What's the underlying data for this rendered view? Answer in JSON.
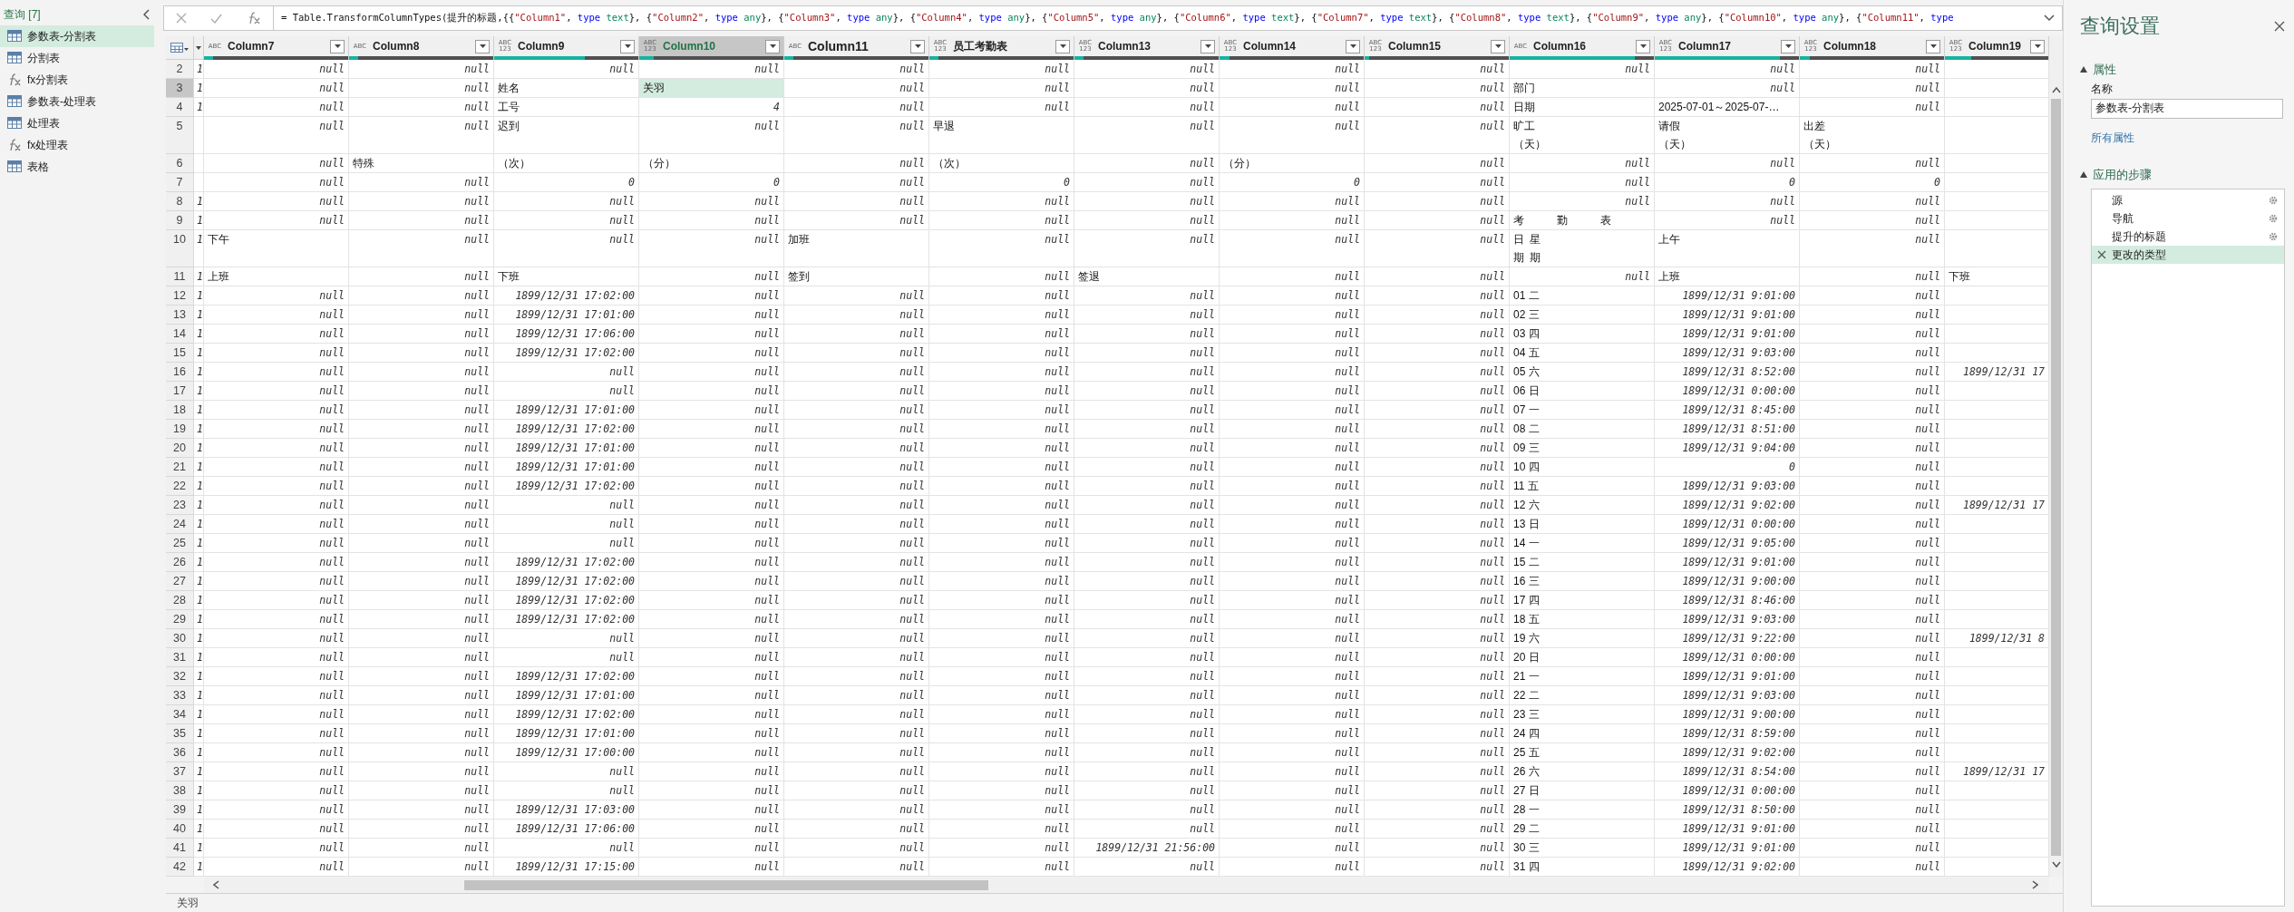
{
  "sidebar": {
    "title": "查询 [7]",
    "items": [
      {
        "label": "参数表-分割表",
        "kind": "table",
        "selected": true
      },
      {
        "label": "分割表",
        "kind": "table",
        "selected": false
      },
      {
        "label": "fx分割表",
        "kind": "function",
        "selected": false
      },
      {
        "label": "参数表-处理表",
        "kind": "table",
        "selected": false
      },
      {
        "label": "处理表",
        "kind": "table",
        "selected": false
      },
      {
        "label": "fx处理表",
        "kind": "function",
        "selected": false
      },
      {
        "label": "表格",
        "kind": "table",
        "selected": false
      }
    ]
  },
  "formula_bar": {
    "segments": [
      {
        "kind": "plain",
        "text": "= Table.TransformColumnTypes(提升的标题,{{"
      },
      {
        "kind": "string",
        "text": "\"Column1\""
      },
      {
        "kind": "plain",
        "text": ", "
      },
      {
        "kind": "keyword",
        "text": "type"
      },
      {
        "kind": "type",
        "text": " text"
      },
      {
        "kind": "plain",
        "text": "}, {"
      },
      {
        "kind": "string",
        "text": "\"Column2\""
      },
      {
        "kind": "plain",
        "text": ", "
      },
      {
        "kind": "keyword",
        "text": "type"
      },
      {
        "kind": "type",
        "text": " any"
      },
      {
        "kind": "plain",
        "text": "}, {"
      },
      {
        "kind": "string",
        "text": "\"Column3\""
      },
      {
        "kind": "plain",
        "text": ", "
      },
      {
        "kind": "keyword",
        "text": "type"
      },
      {
        "kind": "type",
        "text": " any"
      },
      {
        "kind": "plain",
        "text": "}, {"
      },
      {
        "kind": "string",
        "text": "\"Column4\""
      },
      {
        "kind": "plain",
        "text": ", "
      },
      {
        "kind": "keyword",
        "text": "type"
      },
      {
        "kind": "type",
        "text": " any"
      },
      {
        "kind": "plain",
        "text": "}, {"
      },
      {
        "kind": "string",
        "text": "\"Column5\""
      },
      {
        "kind": "plain",
        "text": ", "
      },
      {
        "kind": "keyword",
        "text": "type"
      },
      {
        "kind": "type",
        "text": " any"
      },
      {
        "kind": "plain",
        "text": "}, {"
      },
      {
        "kind": "string",
        "text": "\"Column6\""
      },
      {
        "kind": "plain",
        "text": ", "
      },
      {
        "kind": "keyword",
        "text": "type"
      },
      {
        "kind": "type",
        "text": " text"
      },
      {
        "kind": "plain",
        "text": "}, {"
      },
      {
        "kind": "string",
        "text": "\"Column7\""
      },
      {
        "kind": "plain",
        "text": ", "
      },
      {
        "kind": "keyword",
        "text": "type"
      },
      {
        "kind": "type",
        "text": " text"
      },
      {
        "kind": "plain",
        "text": "}, {"
      },
      {
        "kind": "string",
        "text": "\"Column8\""
      },
      {
        "kind": "plain",
        "text": ", "
      },
      {
        "kind": "keyword",
        "text": "type"
      },
      {
        "kind": "type",
        "text": " text"
      },
      {
        "kind": "plain",
        "text": "}, {"
      },
      {
        "kind": "string",
        "text": "\"Column9\""
      },
      {
        "kind": "plain",
        "text": ", "
      },
      {
        "kind": "keyword",
        "text": "type"
      },
      {
        "kind": "type",
        "text": " any"
      },
      {
        "kind": "plain",
        "text": "}, {"
      },
      {
        "kind": "string",
        "text": "\"Column10\""
      },
      {
        "kind": "plain",
        "text": ", "
      },
      {
        "kind": "keyword",
        "text": "type"
      },
      {
        "kind": "type",
        "text": " any"
      },
      {
        "kind": "plain",
        "text": "}, {"
      },
      {
        "kind": "string",
        "text": "\"Column11\""
      },
      {
        "kind": "plain",
        "text": ", "
      },
      {
        "kind": "keyword",
        "text": "type"
      }
    ]
  },
  "table": {
    "columns": [
      {
        "kind": "clipped",
        "selected": false
      },
      {
        "name": "Column7",
        "type": "ABC",
        "level": 0.06,
        "selected": false
      },
      {
        "name": "Column8",
        "type": "ABC",
        "level": 0.06,
        "selected": false
      },
      {
        "name": "Column9",
        "type": "ABC\n123",
        "level": 0.63,
        "selected": false
      },
      {
        "name": "Column10",
        "type": "ABC\n123",
        "level": 0.1,
        "selected": true
      },
      {
        "name": "Column11",
        "type": "ABC",
        "level": 0.06,
        "selected": false
      },
      {
        "name": "员工考勤表",
        "type": "ABC\n123",
        "level": 0.06,
        "selected": false
      },
      {
        "name": "Column13",
        "type": "ABC\n123",
        "level": 0.06,
        "selected": false
      },
      {
        "name": "Column14",
        "type": "ABC\n123",
        "level": 0.07,
        "selected": false
      },
      {
        "name": "Column15",
        "type": "ABC\n123",
        "level": 0.03,
        "selected": false
      },
      {
        "name": "Column16",
        "type": "ABC",
        "level": 0.87,
        "selected": false
      },
      {
        "name": "Column17",
        "type": "ABC\n123",
        "level": 0.87,
        "selected": false
      },
      {
        "name": "Column18",
        "type": "ABC\n123",
        "level": 0.07,
        "selected": false
      },
      {
        "name": "Column19",
        "type": "ABC\n123",
        "level": 0.25,
        "selected": false
      }
    ],
    "rows": [
      {
        "row": "2",
        "selected": false,
        "cells": [
          "1",
          "null",
          "null",
          "null",
          "null",
          "null",
          "null",
          "null",
          "null",
          "null",
          "null",
          "null",
          "null",
          null
        ]
      },
      {
        "row": "3",
        "selected": true,
        "cells": [
          "1",
          "null",
          "null",
          {
            "text": "姓名"
          },
          {
            "text": "关羽"
          },
          "null",
          "null",
          "null",
          "null",
          "null",
          {
            "text": "部门"
          },
          "null",
          "null",
          null
        ]
      },
      {
        "row": "4",
        "selected": false,
        "cells": [
          "1",
          "null",
          "null",
          {
            "text": "工号"
          },
          "4",
          "null",
          "null",
          "null",
          "null",
          "null",
          {
            "text": "日期"
          },
          {
            "text": "2025-07-01～2025-07-…"
          },
          "null",
          null
        ]
      },
      {
        "row": "5",
        "selected": false,
        "cells": [
          null,
          "null",
          "null",
          {
            "text": "迟到"
          },
          "null",
          "null",
          {
            "text": "早退"
          },
          "null",
          "null",
          "null",
          {
            "kind": "stacked",
            "text": "旷工（天）"
          },
          {
            "kind": "stacked",
            "text": "请假（天）"
          },
          {
            "kind": "stacked",
            "text": "出差（天）"
          },
          null
        ]
      },
      {
        "row": "6",
        "selected": false,
        "cells": [
          null,
          "null",
          {
            "text": "特殊"
          },
          {
            "text": "（次）"
          },
          {
            "text": "（分）"
          },
          "null",
          {
            "text": "（次）"
          },
          "null",
          {
            "text": "（分）"
          },
          "null",
          "null",
          "null",
          "null",
          null
        ]
      },
      {
        "row": "7",
        "selected": false,
        "cells": [
          null,
          "null",
          "null",
          "0",
          "0",
          "null",
          "0",
          "null",
          "0",
          "null",
          "null",
          "0",
          "0",
          null
        ]
      },
      {
        "row": "8",
        "selected": false,
        "cells": [
          "1",
          "null",
          "null",
          "null",
          "null",
          "null",
          "null",
          "null",
          "null",
          "null",
          "null",
          "null",
          "null",
          null
        ]
      },
      {
        "row": "9",
        "selected": false,
        "cells": [
          "1",
          "null",
          "null",
          "null",
          "null",
          "null",
          "null",
          "null",
          "null",
          "null",
          {
            "text": "考　　　勤　　　表"
          },
          "null",
          "null",
          null
        ]
      },
      {
        "row": "10",
        "selected": false,
        "cells": [
          "1",
          {
            "text": "下午"
          },
          "null",
          "null",
          "null",
          {
            "text": "加班"
          },
          "null",
          "null",
          "null",
          "null",
          {
            "kind": "vertical",
            "texts": [
              "日期",
              "星期"
            ]
          },
          {
            "text": "上午"
          },
          "null",
          null
        ]
      },
      {
        "row": "11",
        "selected": false,
        "cells": [
          "1",
          {
            "text": "上班"
          },
          "null",
          {
            "text": "下班"
          },
          "null",
          {
            "text": "签到"
          },
          "null",
          {
            "text": "签退"
          },
          "null",
          "null",
          "null",
          {
            "text": "上班"
          },
          "null",
          {
            "text": "下班"
          }
        ]
      },
      {
        "row": "12",
        "selected": false,
        "cells": [
          "1",
          "null",
          "null",
          "1899/12/31 17:02:00",
          "null",
          "null",
          "null",
          "null",
          "null",
          "null",
          {
            "text": "01 二"
          },
          "1899/12/31 9:01:00",
          "null",
          null
        ]
      },
      {
        "row": "13",
        "selected": false,
        "cells": [
          "1",
          "null",
          "null",
          "1899/12/31 17:01:00",
          "null",
          "null",
          "null",
          "null",
          "null",
          "null",
          {
            "text": "02 三"
          },
          "1899/12/31 9:01:00",
          "null",
          null
        ]
      },
      {
        "row": "14",
        "selected": false,
        "cells": [
          "1",
          "null",
          "null",
          "1899/12/31 17:06:00",
          "null",
          "null",
          "null",
          "null",
          "null",
          "null",
          {
            "text": "03 四"
          },
          "1899/12/31 9:01:00",
          "null",
          null
        ]
      },
      {
        "row": "15",
        "selected": false,
        "cells": [
          "1",
          "null",
          "null",
          "1899/12/31 17:02:00",
          "null",
          "null",
          "null",
          "null",
          "null",
          "null",
          {
            "text": "04 五"
          },
          "1899/12/31 9:03:00",
          "null",
          null
        ]
      },
      {
        "row": "16",
        "selected": false,
        "cells": [
          "1",
          "null",
          "null",
          "null",
          "null",
          "null",
          "null",
          "null",
          "null",
          "null",
          {
            "text": "05 六"
          },
          "1899/12/31 8:52:00",
          "null",
          "1899/12/31 17"
        ]
      },
      {
        "row": "17",
        "selected": false,
        "cells": [
          "1",
          "null",
          "null",
          "null",
          "null",
          "null",
          "null",
          "null",
          "null",
          "null",
          {
            "text": "06 日"
          },
          "1899/12/31 0:00:00",
          "null",
          null
        ]
      },
      {
        "row": "18",
        "selected": false,
        "cells": [
          "1",
          "null",
          "null",
          "1899/12/31 17:01:00",
          "null",
          "null",
          "null",
          "null",
          "null",
          "null",
          {
            "text": "07 一"
          },
          "1899/12/31 8:45:00",
          "null",
          null
        ]
      },
      {
        "row": "19",
        "selected": false,
        "cells": [
          "1",
          "null",
          "null",
          "1899/12/31 17:02:00",
          "null",
          "null",
          "null",
          "null",
          "null",
          "null",
          {
            "text": "08 二"
          },
          "1899/12/31 8:51:00",
          "null",
          null
        ]
      },
      {
        "row": "20",
        "selected": false,
        "cells": [
          "1",
          "null",
          "null",
          "1899/12/31 17:01:00",
          "null",
          "null",
          "null",
          "null",
          "null",
          "null",
          {
            "text": "09 三"
          },
          "1899/12/31 9:04:00",
          "null",
          null
        ]
      },
      {
        "row": "21",
        "selected": false,
        "cells": [
          "1",
          "null",
          "null",
          "1899/12/31 17:01:00",
          "null",
          "null",
          "null",
          "null",
          "null",
          "null",
          {
            "text": "10 四"
          },
          "0",
          "null",
          null
        ]
      },
      {
        "row": "22",
        "selected": false,
        "cells": [
          "1",
          "null",
          "null",
          "1899/12/31 17:02:00",
          "null",
          "null",
          "null",
          "null",
          "null",
          "null",
          {
            "text": "11 五"
          },
          "1899/12/31 9:03:00",
          "null",
          null
        ]
      },
      {
        "row": "23",
        "selected": false,
        "cells": [
          "1",
          "null",
          "null",
          "null",
          "null",
          "null",
          "null",
          "null",
          "null",
          "null",
          {
            "text": "12 六"
          },
          "1899/12/31 9:02:00",
          "null",
          "1899/12/31 17"
        ]
      },
      {
        "row": "24",
        "selected": false,
        "cells": [
          "1",
          "null",
          "null",
          "null",
          "null",
          "null",
          "null",
          "null",
          "null",
          "null",
          {
            "text": "13 日"
          },
          "1899/12/31 0:00:00",
          "null",
          null
        ]
      },
      {
        "row": "25",
        "selected": false,
        "cells": [
          "1",
          "null",
          "null",
          "null",
          "null",
          "null",
          "null",
          "null",
          "null",
          "null",
          {
            "text": "14 一"
          },
          "1899/12/31 9:05:00",
          "null",
          null
        ]
      },
      {
        "row": "26",
        "selected": false,
        "cells": [
          "1",
          "null",
          "null",
          "1899/12/31 17:02:00",
          "null",
          "null",
          "null",
          "null",
          "null",
          "null",
          {
            "text": "15 二"
          },
          "1899/12/31 9:01:00",
          "null",
          null
        ]
      },
      {
        "row": "27",
        "selected": false,
        "cells": [
          "1",
          "null",
          "null",
          "1899/12/31 17:02:00",
          "null",
          "null",
          "null",
          "null",
          "null",
          "null",
          {
            "text": "16 三"
          },
          "1899/12/31 9:00:00",
          "null",
          null
        ]
      },
      {
        "row": "28",
        "selected": false,
        "cells": [
          "1",
          "null",
          "null",
          "1899/12/31 17:02:00",
          "null",
          "null",
          "null",
          "null",
          "null",
          "null",
          {
            "text": "17 四"
          },
          "1899/12/31 8:46:00",
          "null",
          null
        ]
      },
      {
        "row": "29",
        "selected": false,
        "cells": [
          "1",
          "null",
          "null",
          "1899/12/31 17:02:00",
          "null",
          "null",
          "null",
          "null",
          "null",
          "null",
          {
            "text": "18 五"
          },
          "1899/12/31 9:03:00",
          "null",
          null
        ]
      },
      {
        "row": "30",
        "selected": false,
        "cells": [
          "1",
          "null",
          "null",
          "null",
          "null",
          "null",
          "null",
          "null",
          "null",
          "null",
          {
            "text": "19 六"
          },
          "1899/12/31 9:22:00",
          "null",
          "1899/12/31 8"
        ]
      },
      {
        "row": "31",
        "selected": false,
        "cells": [
          "1",
          "null",
          "null",
          "null",
          "null",
          "null",
          "null",
          "null",
          "null",
          "null",
          {
            "text": "20 日"
          },
          "1899/12/31 0:00:00",
          "null",
          null
        ]
      },
      {
        "row": "32",
        "selected": false,
        "cells": [
          "1",
          "null",
          "null",
          "1899/12/31 17:02:00",
          "null",
          "null",
          "null",
          "null",
          "null",
          "null",
          {
            "text": "21 一"
          },
          "1899/12/31 9:01:00",
          "null",
          null
        ]
      },
      {
        "row": "33",
        "selected": false,
        "cells": [
          "1",
          "null",
          "null",
          "1899/12/31 17:01:00",
          "null",
          "null",
          "null",
          "null",
          "null",
          "null",
          {
            "text": "22 二"
          },
          "1899/12/31 9:03:00",
          "null",
          null
        ]
      },
      {
        "row": "34",
        "selected": false,
        "cells": [
          "1",
          "null",
          "null",
          "1899/12/31 17:02:00",
          "null",
          "null",
          "null",
          "null",
          "null",
          "null",
          {
            "text": "23 三"
          },
          "1899/12/31 9:00:00",
          "null",
          null
        ]
      },
      {
        "row": "35",
        "selected": false,
        "cells": [
          "1",
          "null",
          "null",
          "1899/12/31 17:01:00",
          "null",
          "null",
          "null",
          "null",
          "null",
          "null",
          {
            "text": "24 四"
          },
          "1899/12/31 8:59:00",
          "null",
          null
        ]
      },
      {
        "row": "36",
        "selected": false,
        "cells": [
          "1",
          "null",
          "null",
          "1899/12/31 17:00:00",
          "null",
          "null",
          "null",
          "null",
          "null",
          "null",
          {
            "text": "25 五"
          },
          "1899/12/31 9:02:00",
          "null",
          null
        ]
      },
      {
        "row": "37",
        "selected": false,
        "cells": [
          "1",
          "null",
          "null",
          "null",
          "null",
          "null",
          "null",
          "null",
          "null",
          "null",
          {
            "text": "26 六"
          },
          "1899/12/31 8:54:00",
          "null",
          "1899/12/31 17"
        ]
      },
      {
        "row": "38",
        "selected": false,
        "cells": [
          "1",
          "null",
          "null",
          "null",
          "null",
          "null",
          "null",
          "null",
          "null",
          "null",
          {
            "text": "27 日"
          },
          "1899/12/31 0:00:00",
          "null",
          null
        ]
      },
      {
        "row": "39",
        "selected": false,
        "cells": [
          "1",
          "null",
          "null",
          "1899/12/31 17:03:00",
          "null",
          "null",
          "null",
          "null",
          "null",
          "null",
          {
            "text": "28 一"
          },
          "1899/12/31 8:50:00",
          "null",
          null
        ]
      },
      {
        "row": "40",
        "selected": false,
        "cells": [
          "1",
          "null",
          "null",
          "1899/12/31 17:06:00",
          "null",
          "null",
          "null",
          "null",
          "null",
          "null",
          {
            "text": "29 二"
          },
          "1899/12/31 9:01:00",
          "null",
          null
        ]
      },
      {
        "row": "41",
        "selected": false,
        "cells": [
          "1",
          "null",
          "null",
          "null",
          "null",
          "null",
          "null",
          "1899/12/31 21:56:00",
          "null",
          "null",
          {
            "text": "30 三"
          },
          "1899/12/31 9:01:00",
          "null",
          null
        ]
      },
      {
        "row": "42",
        "selected": false,
        "cells": [
          "1",
          "null",
          "null",
          "1899/12/31 17:15:00",
          "null",
          "null",
          "null",
          "null",
          "null",
          "null",
          {
            "text": "31 四"
          },
          "1899/12/31 9:02:00",
          "null",
          null
        ]
      }
    ]
  },
  "status_bar": {
    "text": "关羽"
  },
  "settings_panel": {
    "title": "查询设置",
    "properties_heading": "属性",
    "name_label": "名称",
    "name_value": "参数表-分割表",
    "all_properties_link": "所有属性",
    "steps_heading": "应用的步骤",
    "steps": [
      {
        "label": "源",
        "has_settings": true,
        "selected": false
      },
      {
        "label": "导航",
        "has_settings": true,
        "selected": false
      },
      {
        "label": "提升的标题",
        "has_settings": true,
        "selected": false
      },
      {
        "label": "更改的类型",
        "has_settings": false,
        "selected": true
      }
    ]
  }
}
